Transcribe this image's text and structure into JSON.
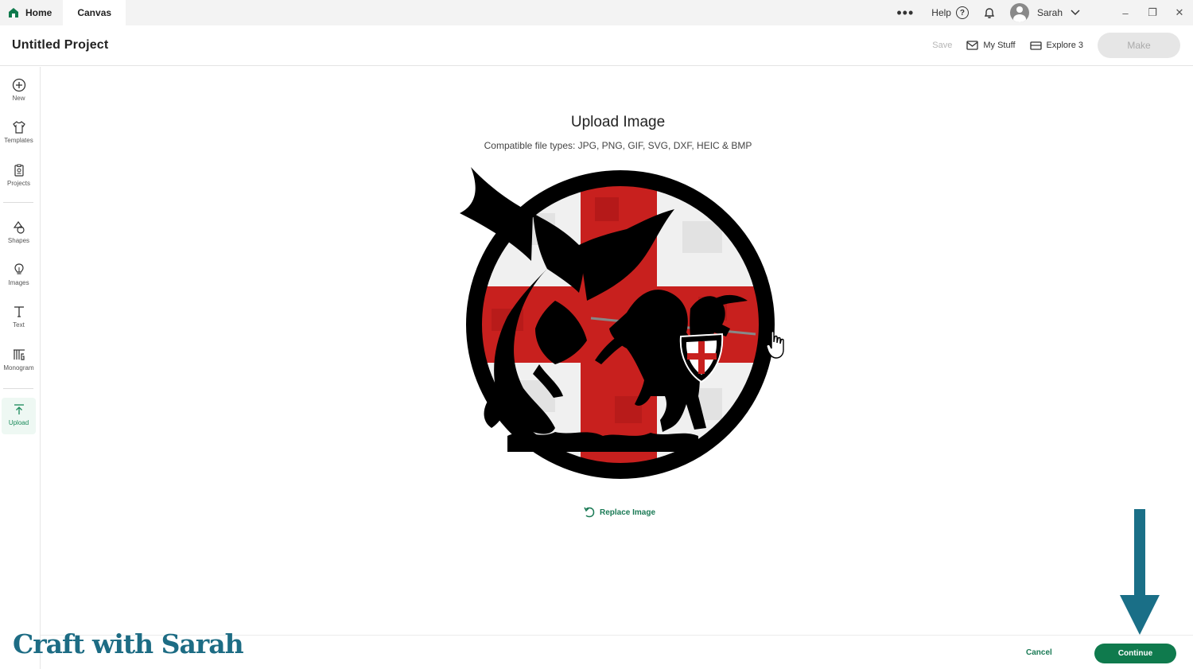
{
  "titlebar": {
    "tabs": [
      {
        "label": "Home"
      },
      {
        "label": "Canvas"
      }
    ],
    "more_label": "•••",
    "help_label": "Help",
    "help_glyph": "?",
    "user_name": "Sarah",
    "window_controls": {
      "minimize": "–",
      "restore": "❐",
      "close": "✕"
    }
  },
  "header": {
    "project_title": "Untitled Project",
    "save_label": "Save",
    "my_stuff_label": "My Stuff",
    "machine_label": "Explore 3",
    "make_label": "Make"
  },
  "sidebar": {
    "items": [
      {
        "label": "New",
        "icon": "plus-circle-icon"
      },
      {
        "label": "Templates",
        "icon": "shirt-icon"
      },
      {
        "label": "Projects",
        "icon": "clipboard-icon"
      },
      {
        "label": "Shapes",
        "icon": "shapes-icon"
      },
      {
        "label": "Images",
        "icon": "bulb-icon"
      },
      {
        "label": "Text",
        "icon": "text-icon"
      },
      {
        "label": "Monogram",
        "icon": "monogram-icon"
      },
      {
        "label": "Upload",
        "icon": "upload-icon"
      }
    ],
    "active": "Upload"
  },
  "main": {
    "title": "Upload Image",
    "subtitle": "Compatible file types:  JPG, PNG, GIF, SVG, DXF, HEIC & BMP",
    "replace_label": "Replace Image"
  },
  "footer": {
    "cancel_label": "Cancel",
    "continue_label": "Continue",
    "brand": "Craft with Sarah"
  },
  "colors": {
    "accent_green": "#0f7a4d",
    "arrow_teal": "#1a6f87",
    "cross_red": "#c8201e"
  }
}
